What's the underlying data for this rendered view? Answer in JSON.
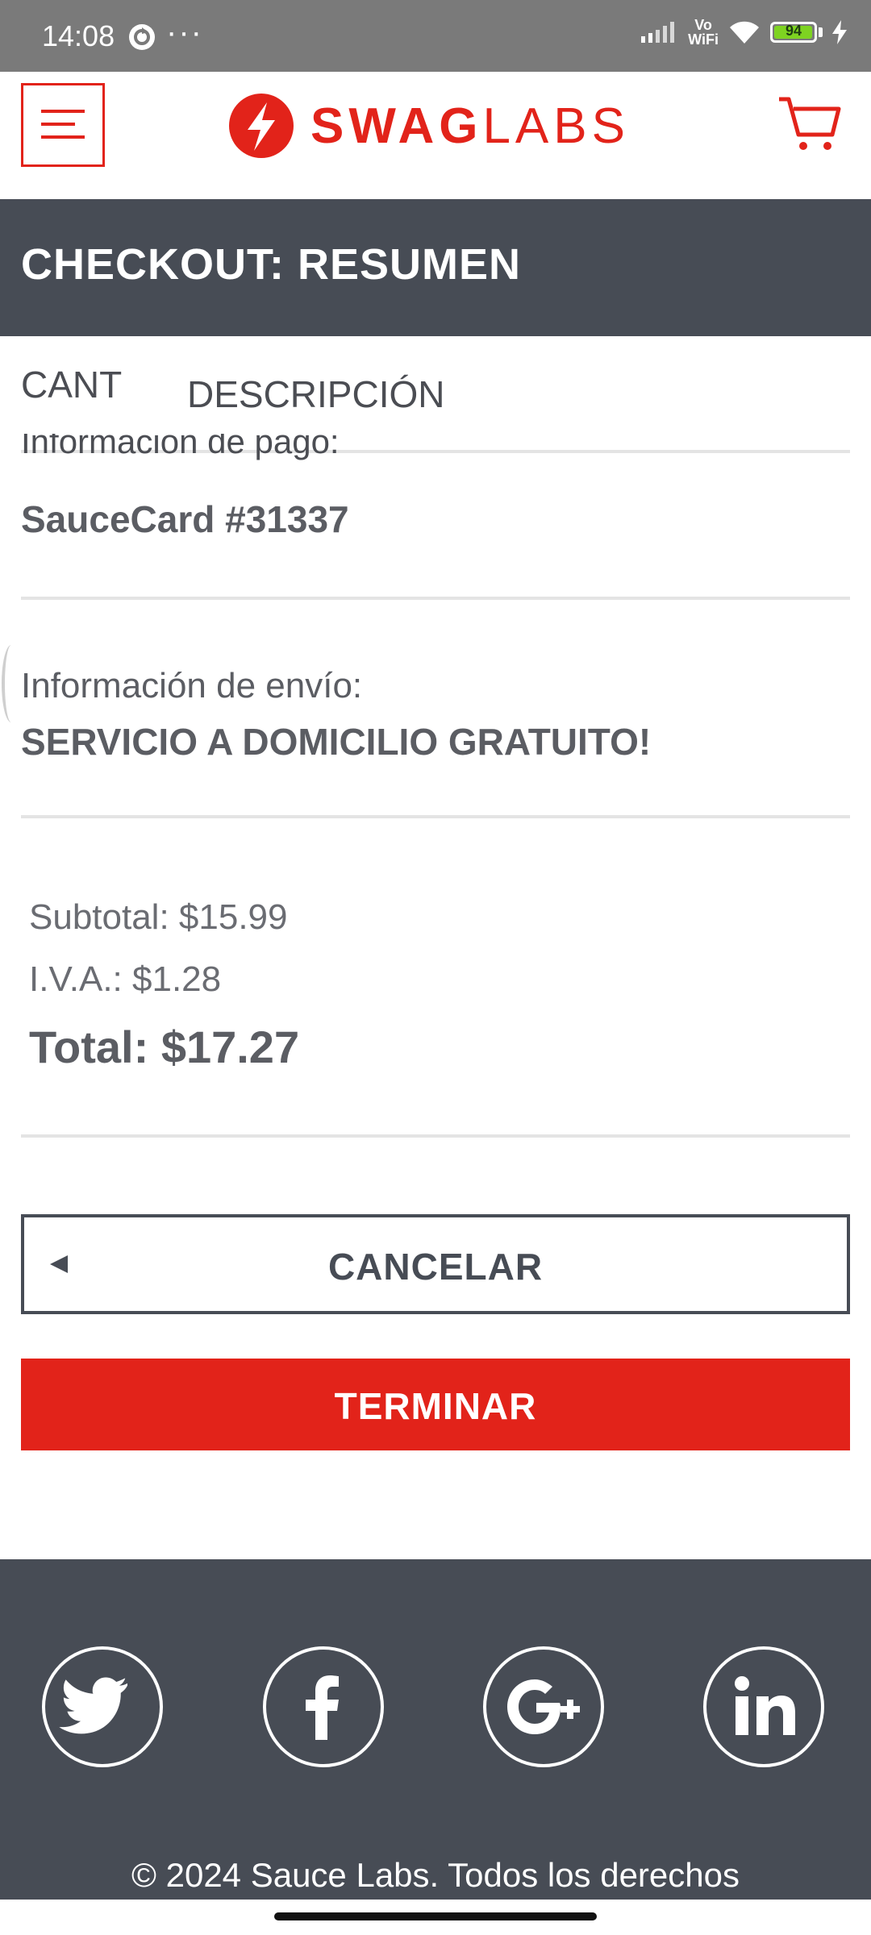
{
  "status_bar": {
    "time": "14:08",
    "dots": "···",
    "vowifi_top": "Vo",
    "vowifi_bottom": "WiFi",
    "battery": "94"
  },
  "header": {
    "brand_bold": "SWAG",
    "brand_light": "LABS",
    "brand_color": "#e2231a"
  },
  "title": "CHECKOUT: RESUMEN",
  "list_header": {
    "qty": "CANT",
    "description": "DESCRIPCIÓN"
  },
  "payment": {
    "label_partial": "Información de pago:",
    "value": "SauceCard #31337"
  },
  "shipping": {
    "label": "Información de envío:",
    "value": "SERVICIO A DOMICILIO GRATUITO!"
  },
  "summary": {
    "subtotal": "Subtotal: $15.99",
    "tax": "I.V.A.: $1.28",
    "total": "Total: $17.27"
  },
  "buttons": {
    "cancel": "CANCELAR",
    "finish": "TERMINAR"
  },
  "footer": {
    "social_icons": [
      "twitter-icon",
      "facebook-icon",
      "google-plus-icon",
      "linkedin-icon"
    ],
    "copyright": "© 2024 Sauce Labs. Todos los derechos"
  },
  "colors": {
    "accent": "#e2231a",
    "dark": "#474c55"
  }
}
